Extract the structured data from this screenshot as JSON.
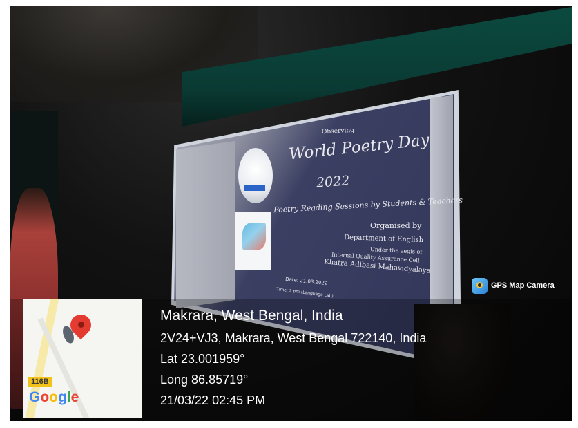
{
  "slide": {
    "observing": "Observing",
    "title": "World Poetry Day",
    "year": "2022",
    "sessions": "Poetry Reading Sessions by Students & Teachers",
    "organised_by": "Organised by",
    "department": "Department of English",
    "aegis": "Under the aegis of",
    "iqac": "Internal Quality Assurance Cell",
    "college": "Khatra Adibasi Mahavidyalaya",
    "date": "Date: 21.03.2022",
    "time": "Time: 2 pm (Language Lab)"
  },
  "watermark": {
    "app_name": "GPS Map Camera",
    "place": "Makrara, West Bengal, India",
    "address": "2V24+VJ3, Makrara, West Bengal 722140, India",
    "latitude": "Lat 23.001959°",
    "longitude": "Long 86.85719°",
    "datetime": "21/03/22 02:45 PM",
    "map_route": "116B",
    "map_brand": "Google"
  },
  "colors": {
    "google_blue": "#4285F4",
    "google_red": "#EA4335",
    "google_yellow": "#FBBC05",
    "google_green": "#34A853",
    "pin_red": "#E33B2F"
  }
}
